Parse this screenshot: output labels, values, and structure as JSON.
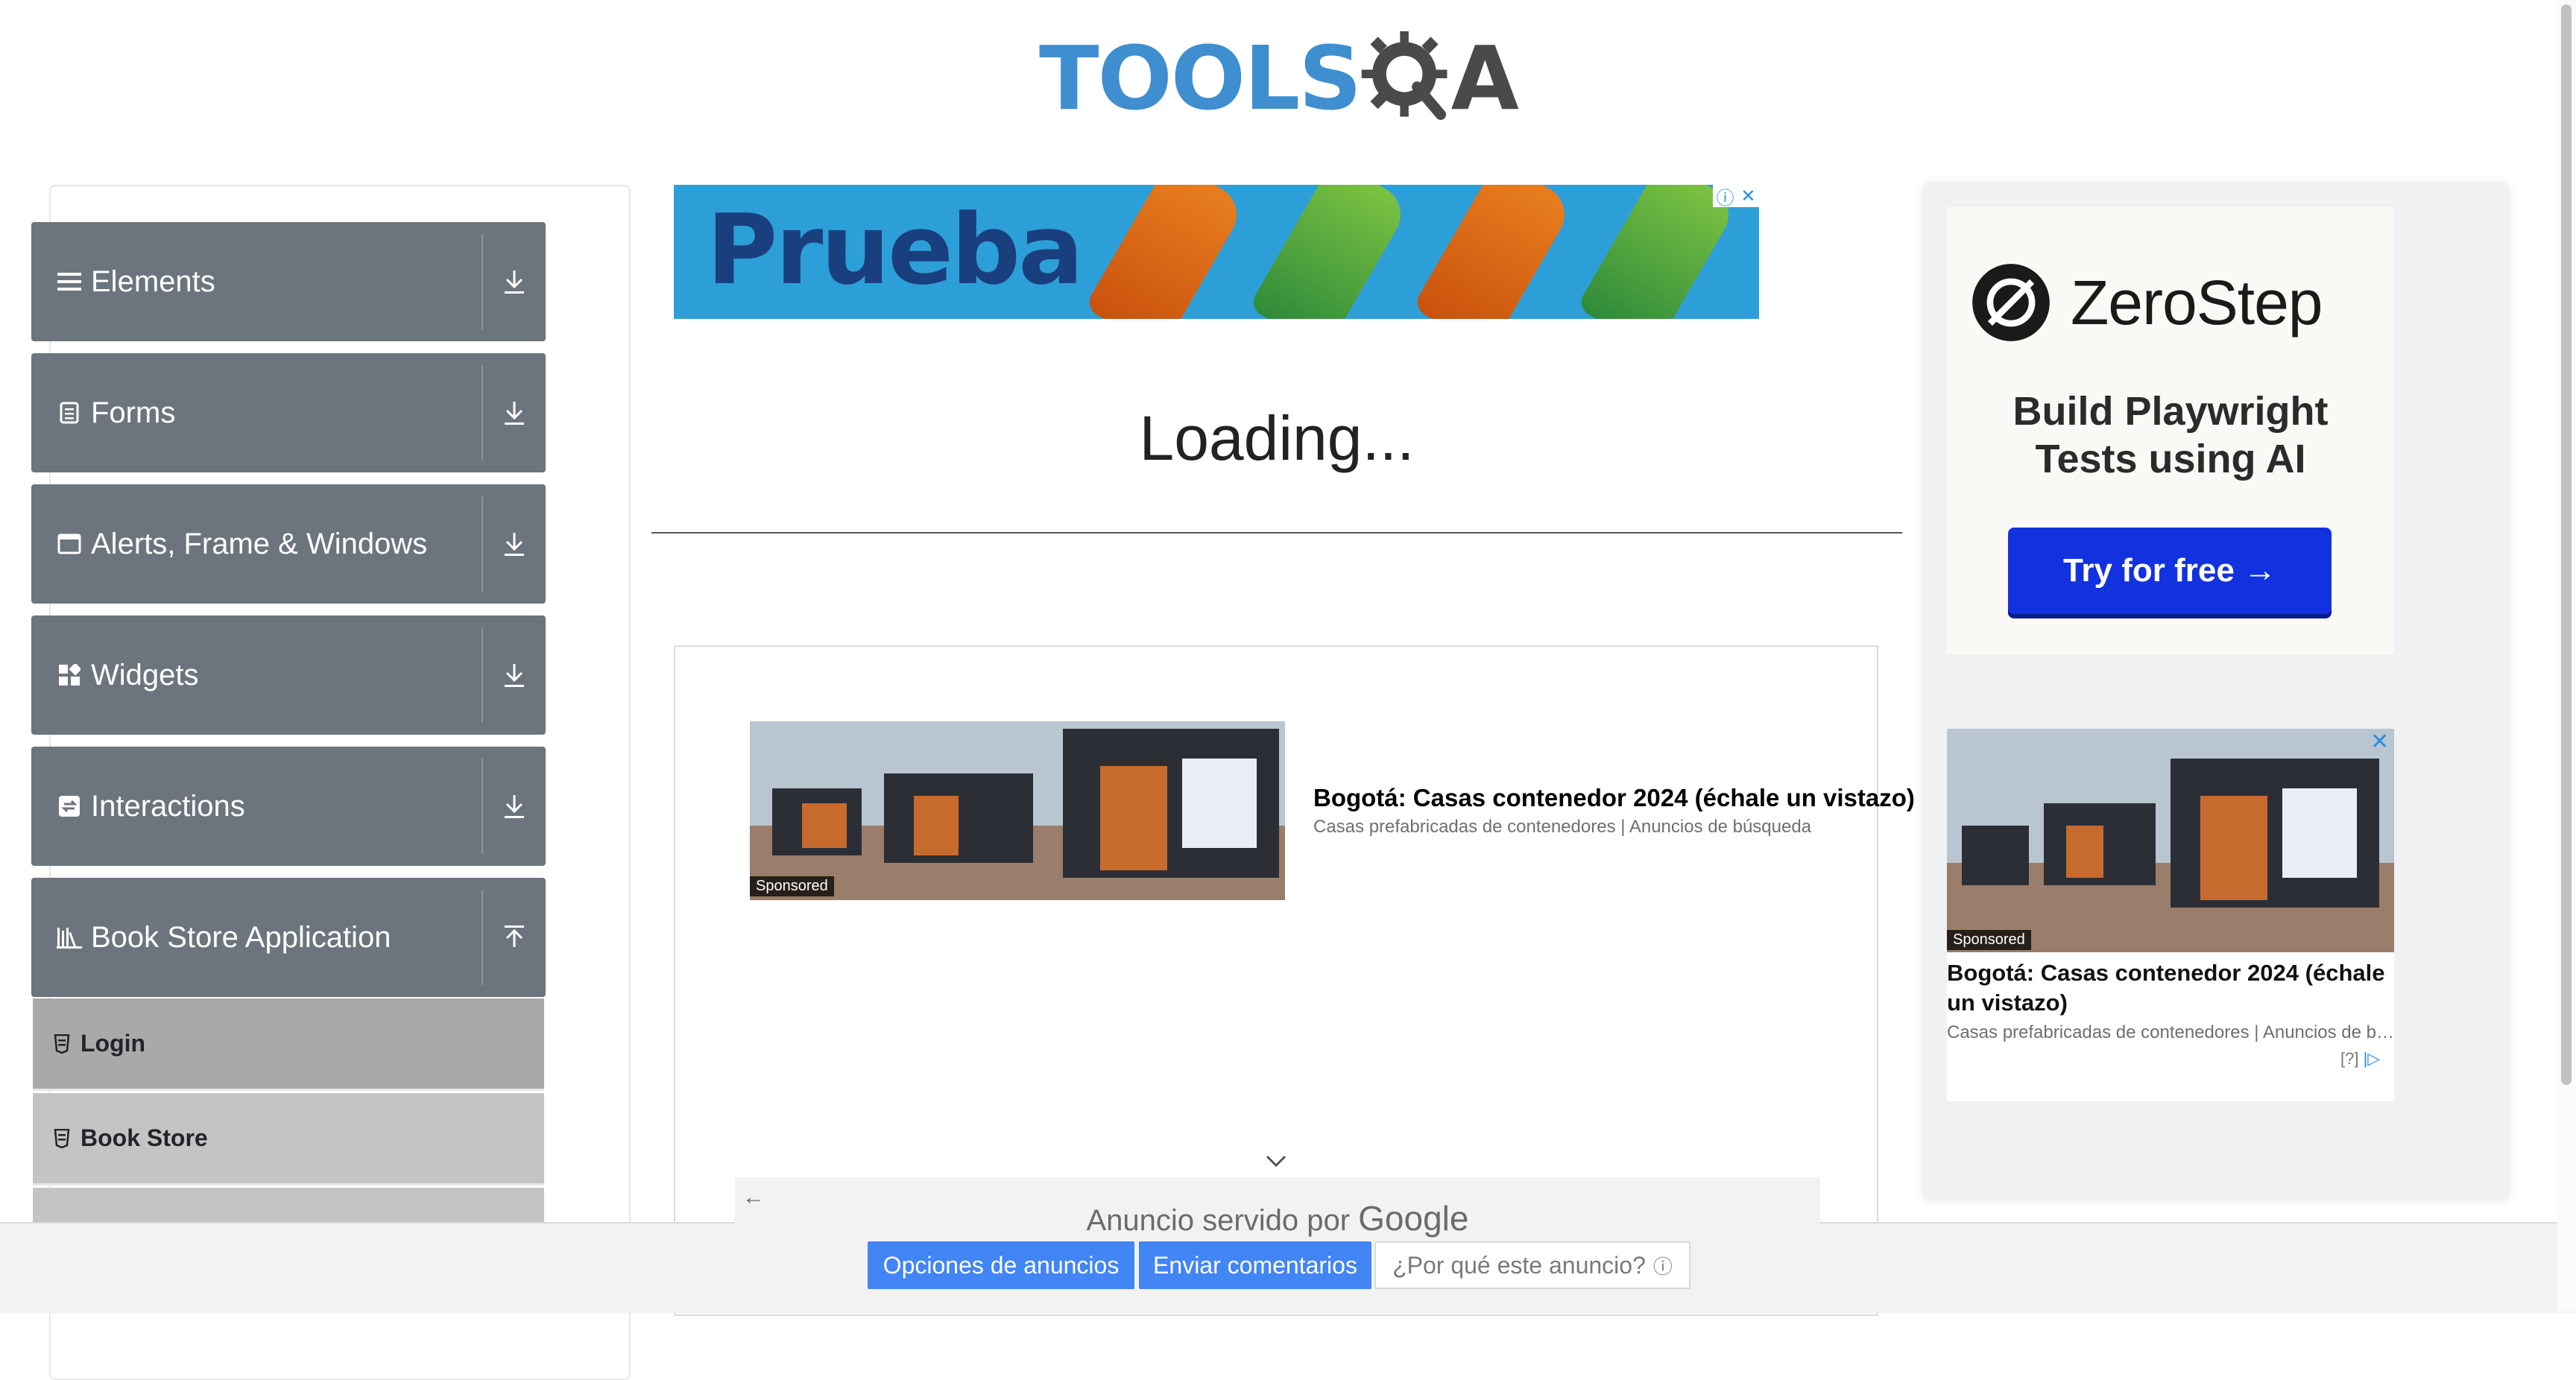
{
  "brand": {
    "tools": "TOOLS",
    "a": "A"
  },
  "sidebar": {
    "groups": [
      {
        "label": "Elements",
        "icon": "hamburger-icon"
      },
      {
        "label": "Forms",
        "icon": "document-icon"
      },
      {
        "label": "Alerts, Frame & Windows",
        "icon": "window-icon"
      },
      {
        "label": "Widgets",
        "icon": "widgets-icon"
      },
      {
        "label": "Interactions",
        "icon": "interactions-icon"
      },
      {
        "label": "Book Store Application",
        "icon": "books-icon"
      }
    ],
    "book_store_items": [
      {
        "label": "Login",
        "active": true
      },
      {
        "label": "Book Store",
        "active": false
      }
    ]
  },
  "main": {
    "banner_ad_text": "Prueba",
    "loading_text": "Loading..."
  },
  "native_ad": {
    "badge": "Sponsored",
    "title": "Bogotá: Casas contenedor 2024 (échale un vistazo)",
    "subtitle": "Casas prefabricadas de contenedores | Anuncios de búsqueda"
  },
  "google_footer": {
    "served_by": "Anuncio servido por",
    "google": "Google",
    "options_button": "Opciones de anuncios",
    "feedback_button": "Enviar comentarios",
    "why_button": "¿Por qué este anuncio?"
  },
  "right_ad": {
    "brand": "ZeroStep",
    "headline_line1": "Build Playwright",
    "headline_line2": "Tests using AI",
    "cta": "Try for free →",
    "native_badge": "Sponsored",
    "native_title": "Bogotá: Casas contenedor 2024 (échale un vistazo)",
    "native_sub": "Casas prefabricadas de contenedores | Anuncios de b…",
    "adchoices": "[?]"
  },
  "colors": {
    "sidebar_group_bg": "#6c757d",
    "sidebar_item_active": "#a9a9a9",
    "google_blue": "#4285f4",
    "zerostep_blue": "#1232e0",
    "logo_blue": "#3e8ed0"
  }
}
